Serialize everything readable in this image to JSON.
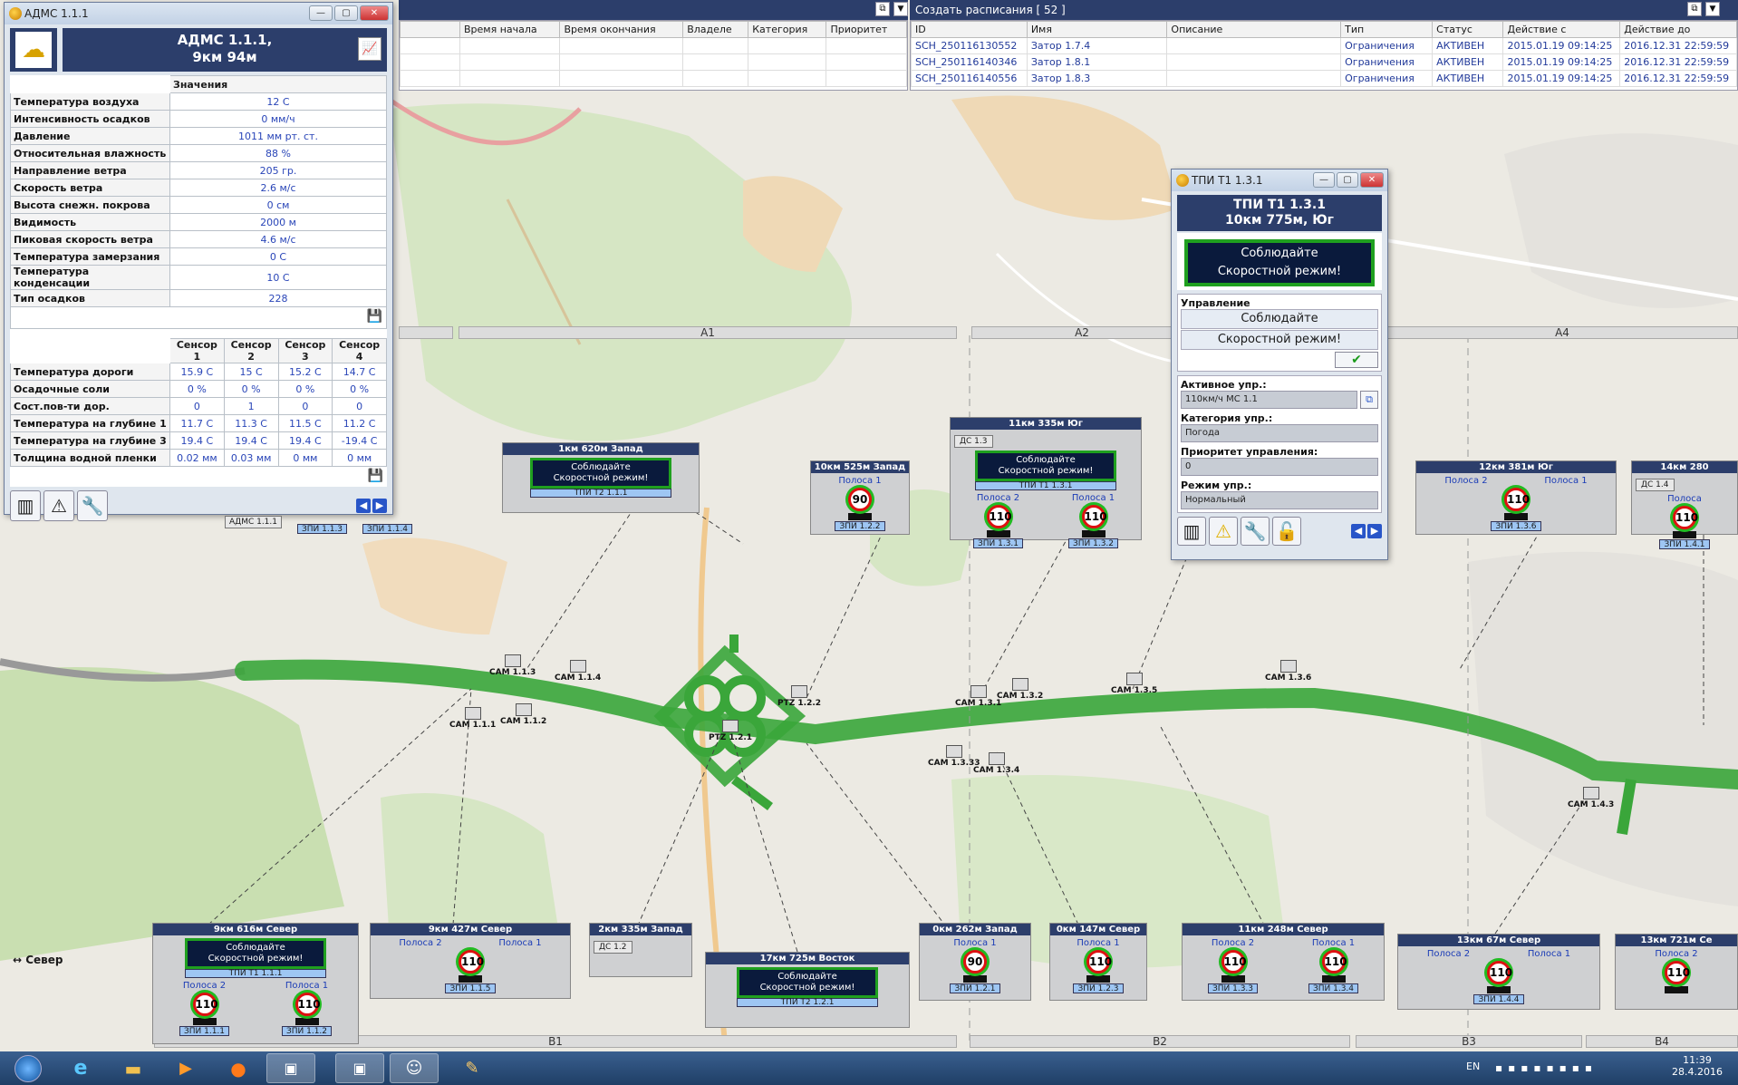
{
  "adms": {
    "title": "АДМС 1.1.1",
    "heading_line1": "АДМС 1.1.1,",
    "heading_line2": "9км 94м",
    "values_header": "Значения",
    "rows": [
      {
        "label": "Температура воздуха",
        "value": "12 С"
      },
      {
        "label": "Интенсивность осадков",
        "value": "0 мм/ч"
      },
      {
        "label": "Давление",
        "value": "1011 мм рт. ст."
      },
      {
        "label": "Относительная влажность",
        "value": "88 %"
      },
      {
        "label": "Направление ветра",
        "value": "205 гр."
      },
      {
        "label": "Скорость ветра",
        "value": "2.6 м/с"
      },
      {
        "label": "Высота снежн. покрова",
        "value": "0 см"
      },
      {
        "label": "Видимость",
        "value": "2000 м"
      },
      {
        "label": "Пиковая скорость ветра",
        "value": "4.6 м/с"
      },
      {
        "label": "Температура замерзания",
        "value": "0 С"
      },
      {
        "label": "Температура конденсации",
        "value": "10 С"
      },
      {
        "label": "Тип осадков",
        "value": "228"
      }
    ],
    "sensor_headers": [
      "Сенсор 1",
      "Сенсор 2",
      "Сенсор 3",
      "Сенсор 4"
    ],
    "sensor_rows": [
      {
        "label": "Температура дороги",
        "values": [
          "15.9 С",
          "15 С",
          "15.2 С",
          "14.7 С"
        ]
      },
      {
        "label": "Осадочные соли",
        "values": [
          "0 %",
          "0 %",
          "0 %",
          "0 %"
        ]
      },
      {
        "label": "Сост.пов-ти дор.",
        "values": [
          "0",
          "1",
          "0",
          "0"
        ]
      },
      {
        "label": "Температура на глубине 1",
        "values": [
          "11.7 С",
          "11.3 С",
          "11.5 С",
          "11.2 С"
        ]
      },
      {
        "label": "Температура на глубине 3",
        "values": [
          "19.4 С",
          "19.4 С",
          "19.4 С",
          "-19.4 С"
        ]
      },
      {
        "label": "Толщина водной пленки",
        "values": [
          "0.02 мм",
          "0.03 мм",
          "0 мм",
          "0 мм"
        ]
      }
    ]
  },
  "schedule_left": {
    "columns": [
      "Время начала",
      "Время окончания",
      "Владеле",
      "Категория",
      "Приоритет"
    ]
  },
  "schedule": {
    "title": "Создать расписания [ 52 ]",
    "columns": [
      "ID",
      "Имя",
      "Описание",
      "Тип",
      "Статус",
      "Действие с",
      "Действие до"
    ],
    "rows": [
      [
        "SCH_250116130552",
        "Затор 1.7.4",
        "",
        "Ограничения",
        "АКТИВЕН",
        "2015.01.19 09:14:25",
        "2016.12.31 22:59:59"
      ],
      [
        "SCH_250116140346",
        "Затор 1.8.1",
        "",
        "Ограничения",
        "АКТИВЕН",
        "2015.01.19 09:14:25",
        "2016.12.31 22:59:59"
      ],
      [
        "SCH_250116140556",
        "Затор 1.8.3",
        "",
        "Ограничения",
        "АКТИВЕН",
        "2015.01.19 09:14:25",
        "2016.12.31 22:59:59"
      ]
    ]
  },
  "tpi": {
    "title": "ТПИ Т1 1.3.1",
    "heading_line1": "ТПИ Т1 1.3.1",
    "heading_line2": "10км 775м, Юг",
    "vms_line1": "Соблюдайте",
    "vms_line2": "Скоростной режим!",
    "control_label": "Управление",
    "control_line1": "Соблюдайте",
    "control_line2": "Скоростной режим!",
    "active_label": "Активное упр.:",
    "active_value": "110км/ч МС 1.1",
    "category_label": "Категория упр.:",
    "category_value": "Погода",
    "priority_label": "Приоритет управления:",
    "priority_value": "0",
    "mode_label": "Режим упр.:",
    "mode_value": "Нормальный"
  },
  "zones_top": [
    "A1",
    "A2",
    "A4"
  ],
  "zones_bottom": [
    "B1",
    "B2",
    "B3",
    "B4"
  ],
  "map_labels": {
    "sever": "Север"
  },
  "panels": [
    {
      "id": "p1",
      "title": "1км 620м Запад",
      "vms1": "Соблюдайте",
      "vms2": "Скоростной режим!",
      "vms_label": "ТПИ Т2 1.1.1"
    },
    {
      "id": "p2",
      "title": "10км 525м Запад",
      "lane": "Полоса 1",
      "speed": "90",
      "sign": "ЗПИ 1.2.2"
    },
    {
      "id": "p3",
      "title": "11км 335м Юг",
      "ds": "ДС 1.3",
      "vms1": "Соблюдайте",
      "vms2": "Скоростной режим!",
      "vms_label": "ТПИ Т1 1.3.1",
      "lane_a": "Полоса 2",
      "lane_b": "Полоса 1",
      "speed_a": "110",
      "speed_b": "110",
      "sign_a": "ЗПИ 1.3.1",
      "sign_b": "ЗПИ 1.3.2"
    },
    {
      "id": "p4",
      "title": "12км 381м Юг",
      "lane_a": "Полоса 2",
      "lane_b": "Полоса 1",
      "speed": "110",
      "sign": "ЗПИ 1.3.6"
    },
    {
      "id": "p5",
      "title": "14км 280",
      "ds": "ДС 1.4",
      "lane": "Полоса",
      "speed": "110",
      "sign": "ЗПИ 1.4.1"
    },
    {
      "id": "p6",
      "title": "9км 616м Север",
      "vms1": "Соблюдайте",
      "vms2": "Скоростной режим!",
      "vms_label": "ТПИ Т1 1.1.1",
      "lane_a": "Полоса 2",
      "lane_b": "Полоса 1",
      "speed_a": "110",
      "speed_b": "110",
      "sign_a": "ЗПИ 1.1.1",
      "sign_b": "ЗПИ 1.1.2"
    },
    {
      "id": "p7",
      "title": "9км 427м Север",
      "lane_a": "Полоса 2",
      "lane_b": "Полоса 1",
      "speed": "110",
      "sign": "ЗПИ 1.1.5"
    },
    {
      "id": "p8",
      "title": "2км 335м Запад",
      "ds": "ДС 1.2"
    },
    {
      "id": "p9",
      "title": "17км 725м Восток",
      "vms1": "Соблюдайте",
      "vms2": "Скоростной режим!",
      "vms_label": "ТПИ Т2 1.2.1"
    },
    {
      "id": "p10",
      "title": "0км 262м Запад",
      "lane": "Полоса 1",
      "speed": "90",
      "sign": "ЗПИ 1.2.1"
    },
    {
      "id": "p11",
      "title": "0км 147м Север",
      "lane": "Полоса 1",
      "speed": "110",
      "sign": "ЗПИ 1.2.3"
    },
    {
      "id": "p12",
      "title": "11км 248м Север",
      "lane_a": "Полоса 2",
      "lane_b": "Полоса 1",
      "speed_a": "110",
      "speed_b": "110",
      "sign_a": "ЗПИ 1.3.3",
      "sign_b": "ЗПИ 1.3.4"
    },
    {
      "id": "p13",
      "title": "13км 67м Север",
      "lane_a": "Полоса 2",
      "lane_b": "Полоса 1",
      "speed": "110",
      "sign": "ЗПИ 1.4.4"
    },
    {
      "id": "p14",
      "title": "13км 721м Се",
      "lane": "Полоса 2",
      "speed": "110",
      "sign": ""
    }
  ],
  "cameras": [
    "CAM 1.1.3",
    "CAM 1.1.4",
    "CAM 1.1.1",
    "CAM 1.1.2",
    "PTZ 1.2.1",
    "PTZ 1.2.2",
    "CAM 1.3.1",
    "CAM 1.3.2",
    "CAM 1.3.33",
    "CAM 1.3.4",
    "CAM 1.3.5",
    "CAM 1.3.6",
    "CAM 1.4.3"
  ],
  "small_labels": {
    "adms": "АДМС 1.1.1",
    "zpi113": "ЗПИ 1.1.3",
    "zpi114": "ЗПИ 1.1.4"
  },
  "taskbar": {
    "lang": "EN",
    "time": "11:39",
    "date": "28.4.2016"
  },
  "colors": {
    "accent": "#2c3e6b",
    "road": "#3aa63a",
    "vms_border": "#1fa01f"
  }
}
